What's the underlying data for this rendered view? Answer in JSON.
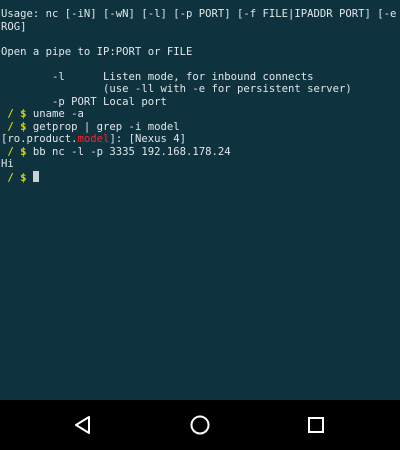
{
  "terminal": {
    "lines": [
      {
        "text": "Usage: nc [-iN] [-wN] [-l] [-p PORT] [-f FILE|IPADDR PORT] [-e P"
      },
      {
        "text": "ROG]"
      },
      {
        "text": ""
      },
      {
        "text": "Open a pipe to IP:PORT or FILE"
      },
      {
        "text": ""
      },
      {
        "text": "        -l      Listen mode, for inbound connects"
      },
      {
        "text": "                (use -ll with -e for persistent server)"
      },
      {
        "text": "        -p PORT Local port"
      },
      {
        "prompt": " / $ ",
        "command": "uname -a"
      },
      {
        "prompt": " / $ ",
        "command": "getprop | grep -i model"
      },
      {
        "pre": "[ro.product.",
        "highlight": "model",
        "post": "]: [Nexus 4]"
      },
      {
        "prompt": " / $ ",
        "command": "bb nc -l -p 3335 192.168.178.24"
      },
      {
        "text": "Hi"
      },
      {
        "prompt": " / $ ",
        "command": "",
        "cursor": true
      }
    ]
  },
  "navbar": {
    "buttons": [
      {
        "name": "back",
        "icon": "back-triangle-icon"
      },
      {
        "name": "home",
        "icon": "home-circle-icon"
      },
      {
        "name": "recents",
        "icon": "recents-square-icon"
      }
    ]
  },
  "colors": {
    "terminal_bg": "#0f323f",
    "terminal_fg": "#dfe7ea",
    "prompt": "#d6d600",
    "highlight": "#ff2020",
    "navbar_bg": "#000000"
  }
}
